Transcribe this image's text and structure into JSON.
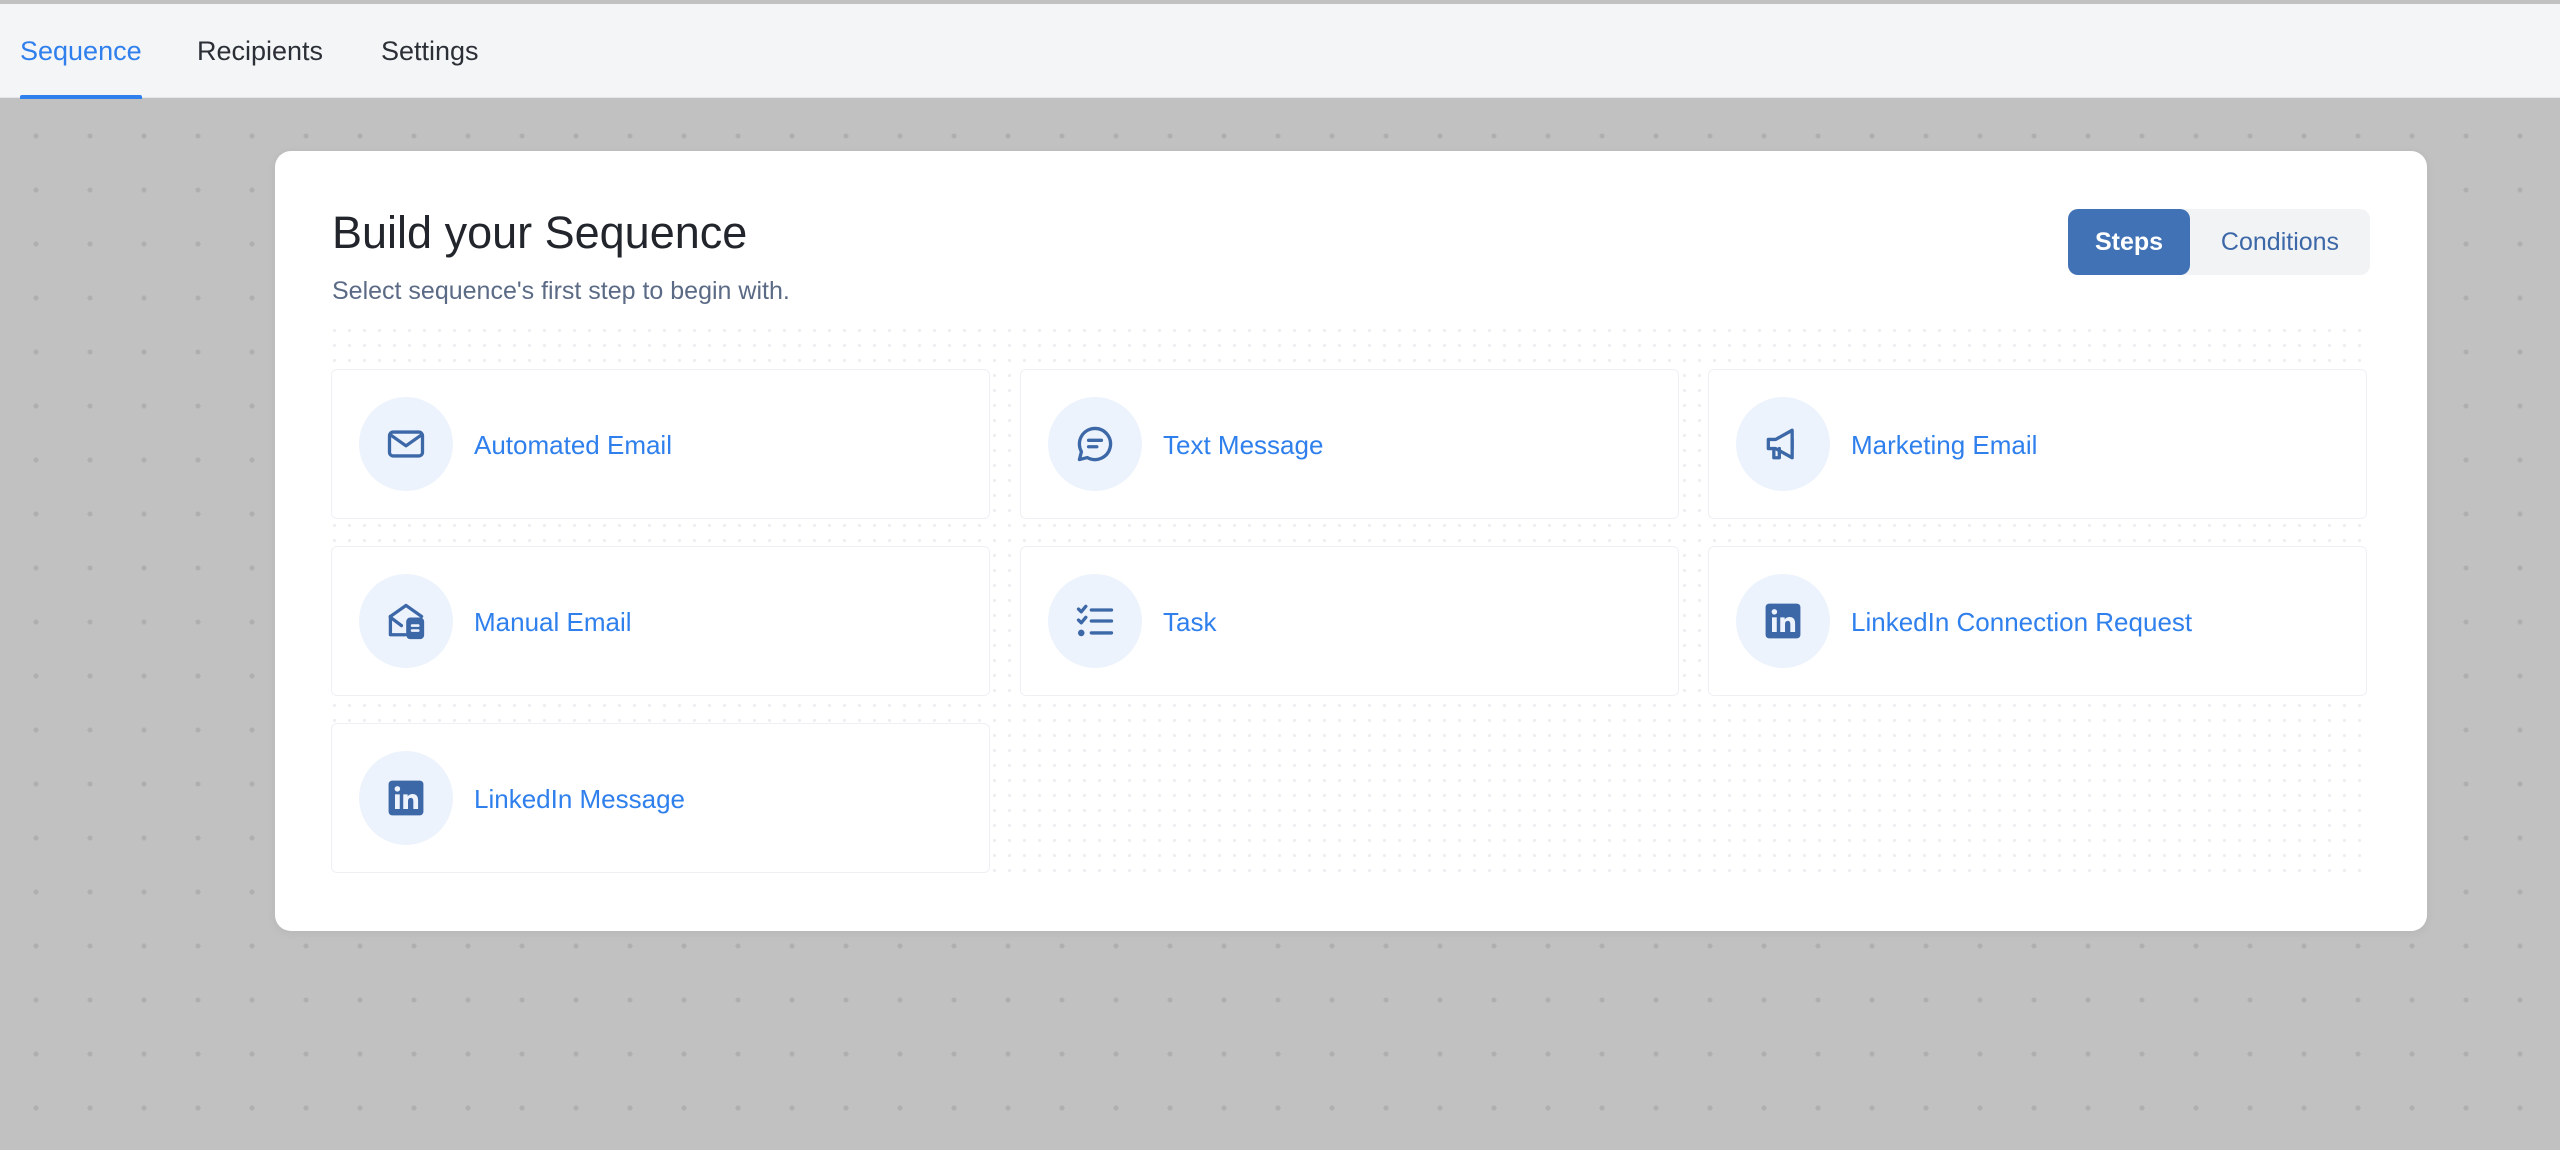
{
  "tabs": [
    {
      "label": "Sequence",
      "active": true
    },
    {
      "label": "Recipients",
      "active": false
    },
    {
      "label": "Settings",
      "active": false
    }
  ],
  "builder": {
    "title": "Build your Sequence",
    "subtitle": "Select sequence's first step to begin with.",
    "toggle": {
      "steps_label": "Steps",
      "conditions_label": "Conditions",
      "selected": "Steps"
    },
    "steps": [
      {
        "label": "Automated Email",
        "icon": "envelope-icon"
      },
      {
        "label": "Text Message",
        "icon": "chat-bubble-icon"
      },
      {
        "label": "Marketing Email",
        "icon": "megaphone-icon"
      },
      {
        "label": "Manual Email",
        "icon": "manual-email-icon"
      },
      {
        "label": "Task",
        "icon": "task-list-icon"
      },
      {
        "label": "LinkedIn Connection Request",
        "icon": "linkedin-icon"
      },
      {
        "label": "LinkedIn Message",
        "icon": "linkedin-icon"
      }
    ]
  },
  "colors": {
    "accent": "#2f80ed",
    "toggle_active": "#4272b6",
    "icon": "#3d68a8",
    "icon_circle": "#edf3fc",
    "backdrop": "#c1c1c1"
  }
}
